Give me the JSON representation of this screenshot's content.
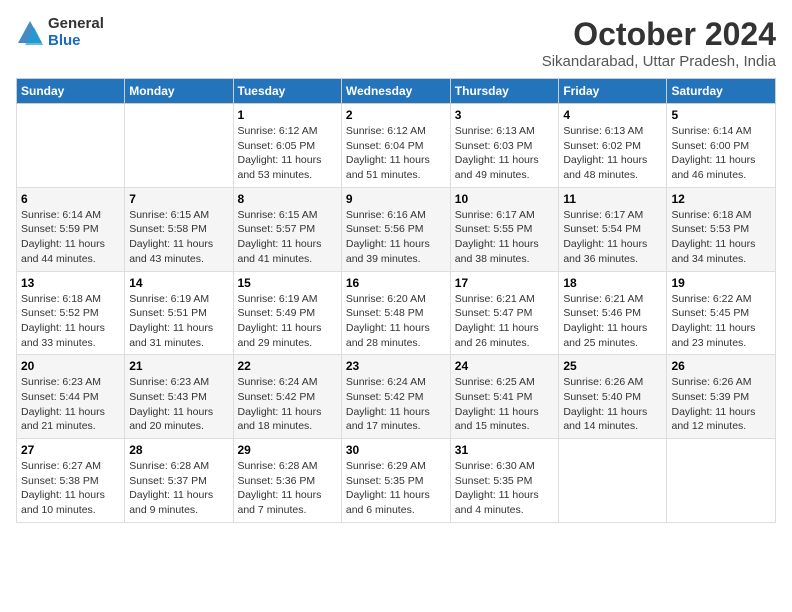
{
  "logo": {
    "general": "General",
    "blue": "Blue"
  },
  "title": "October 2024",
  "location": "Sikandarabad, Uttar Pradesh, India",
  "days_of_week": [
    "Sunday",
    "Monday",
    "Tuesday",
    "Wednesday",
    "Thursday",
    "Friday",
    "Saturday"
  ],
  "weeks": [
    [
      {
        "day": "",
        "info": ""
      },
      {
        "day": "",
        "info": ""
      },
      {
        "day": "1",
        "info": "Sunrise: 6:12 AM\nSunset: 6:05 PM\nDaylight: 11 hours and 53 minutes."
      },
      {
        "day": "2",
        "info": "Sunrise: 6:12 AM\nSunset: 6:04 PM\nDaylight: 11 hours and 51 minutes."
      },
      {
        "day": "3",
        "info": "Sunrise: 6:13 AM\nSunset: 6:03 PM\nDaylight: 11 hours and 49 minutes."
      },
      {
        "day": "4",
        "info": "Sunrise: 6:13 AM\nSunset: 6:02 PM\nDaylight: 11 hours and 48 minutes."
      },
      {
        "day": "5",
        "info": "Sunrise: 6:14 AM\nSunset: 6:00 PM\nDaylight: 11 hours and 46 minutes."
      }
    ],
    [
      {
        "day": "6",
        "info": "Sunrise: 6:14 AM\nSunset: 5:59 PM\nDaylight: 11 hours and 44 minutes."
      },
      {
        "day": "7",
        "info": "Sunrise: 6:15 AM\nSunset: 5:58 PM\nDaylight: 11 hours and 43 minutes."
      },
      {
        "day": "8",
        "info": "Sunrise: 6:15 AM\nSunset: 5:57 PM\nDaylight: 11 hours and 41 minutes."
      },
      {
        "day": "9",
        "info": "Sunrise: 6:16 AM\nSunset: 5:56 PM\nDaylight: 11 hours and 39 minutes."
      },
      {
        "day": "10",
        "info": "Sunrise: 6:17 AM\nSunset: 5:55 PM\nDaylight: 11 hours and 38 minutes."
      },
      {
        "day": "11",
        "info": "Sunrise: 6:17 AM\nSunset: 5:54 PM\nDaylight: 11 hours and 36 minutes."
      },
      {
        "day": "12",
        "info": "Sunrise: 6:18 AM\nSunset: 5:53 PM\nDaylight: 11 hours and 34 minutes."
      }
    ],
    [
      {
        "day": "13",
        "info": "Sunrise: 6:18 AM\nSunset: 5:52 PM\nDaylight: 11 hours and 33 minutes."
      },
      {
        "day": "14",
        "info": "Sunrise: 6:19 AM\nSunset: 5:51 PM\nDaylight: 11 hours and 31 minutes."
      },
      {
        "day": "15",
        "info": "Sunrise: 6:19 AM\nSunset: 5:49 PM\nDaylight: 11 hours and 29 minutes."
      },
      {
        "day": "16",
        "info": "Sunrise: 6:20 AM\nSunset: 5:48 PM\nDaylight: 11 hours and 28 minutes."
      },
      {
        "day": "17",
        "info": "Sunrise: 6:21 AM\nSunset: 5:47 PM\nDaylight: 11 hours and 26 minutes."
      },
      {
        "day": "18",
        "info": "Sunrise: 6:21 AM\nSunset: 5:46 PM\nDaylight: 11 hours and 25 minutes."
      },
      {
        "day": "19",
        "info": "Sunrise: 6:22 AM\nSunset: 5:45 PM\nDaylight: 11 hours and 23 minutes."
      }
    ],
    [
      {
        "day": "20",
        "info": "Sunrise: 6:23 AM\nSunset: 5:44 PM\nDaylight: 11 hours and 21 minutes."
      },
      {
        "day": "21",
        "info": "Sunrise: 6:23 AM\nSunset: 5:43 PM\nDaylight: 11 hours and 20 minutes."
      },
      {
        "day": "22",
        "info": "Sunrise: 6:24 AM\nSunset: 5:42 PM\nDaylight: 11 hours and 18 minutes."
      },
      {
        "day": "23",
        "info": "Sunrise: 6:24 AM\nSunset: 5:42 PM\nDaylight: 11 hours and 17 minutes."
      },
      {
        "day": "24",
        "info": "Sunrise: 6:25 AM\nSunset: 5:41 PM\nDaylight: 11 hours and 15 minutes."
      },
      {
        "day": "25",
        "info": "Sunrise: 6:26 AM\nSunset: 5:40 PM\nDaylight: 11 hours and 14 minutes."
      },
      {
        "day": "26",
        "info": "Sunrise: 6:26 AM\nSunset: 5:39 PM\nDaylight: 11 hours and 12 minutes."
      }
    ],
    [
      {
        "day": "27",
        "info": "Sunrise: 6:27 AM\nSunset: 5:38 PM\nDaylight: 11 hours and 10 minutes."
      },
      {
        "day": "28",
        "info": "Sunrise: 6:28 AM\nSunset: 5:37 PM\nDaylight: 11 hours and 9 minutes."
      },
      {
        "day": "29",
        "info": "Sunrise: 6:28 AM\nSunset: 5:36 PM\nDaylight: 11 hours and 7 minutes."
      },
      {
        "day": "30",
        "info": "Sunrise: 6:29 AM\nSunset: 5:35 PM\nDaylight: 11 hours and 6 minutes."
      },
      {
        "day": "31",
        "info": "Sunrise: 6:30 AM\nSunset: 5:35 PM\nDaylight: 11 hours and 4 minutes."
      },
      {
        "day": "",
        "info": ""
      },
      {
        "day": "",
        "info": ""
      }
    ]
  ]
}
